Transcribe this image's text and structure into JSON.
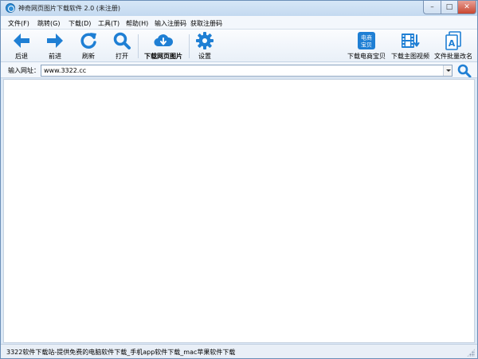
{
  "window": {
    "title": "神奇网页图片下载软件 2.0 (未注册)",
    "controls": {
      "minimize": "–",
      "maximize": "□",
      "close": "✕"
    }
  },
  "menu": {
    "items": [
      {
        "label": "文件(F)"
      },
      {
        "label": "跳转(G)"
      },
      {
        "label": "下载(D)"
      },
      {
        "label": "工具(T)"
      },
      {
        "label": "帮助(H)"
      },
      {
        "label": "输入注册码"
      },
      {
        "label": "获取注册码"
      }
    ]
  },
  "toolbar": {
    "back": {
      "label": "后退",
      "icon": "arrow-left-icon"
    },
    "forward": {
      "label": "前进",
      "icon": "arrow-right-icon"
    },
    "refresh": {
      "label": "刷新",
      "icon": "refresh-icon"
    },
    "open": {
      "label": "打开",
      "icon": "magnifier-icon"
    },
    "download_images": {
      "label": "下载网页图片",
      "icon": "cloud-download-icon"
    },
    "settings": {
      "label": "设置",
      "icon": "gear-icon"
    },
    "ecommerce": {
      "label": "下载电商宝贝",
      "icon": "ecommerce-icon",
      "icon_text": [
        "电商",
        "宝贝"
      ]
    },
    "video": {
      "label": "下载主图视频",
      "icon": "film-download-icon"
    },
    "rename": {
      "label": "文件批量改名",
      "icon": "file-rename-icon"
    }
  },
  "address": {
    "label": "输入网址：",
    "value": "www.3322.cc"
  },
  "status": {
    "text": "3322软件下载站-提供免费的电脑软件下载_手机app软件下载_mac苹果软件下载"
  },
  "colors": {
    "icon_blue": "#1f7fd4",
    "title_bar": "#c3d9f0",
    "close_red": "#c8462f"
  }
}
